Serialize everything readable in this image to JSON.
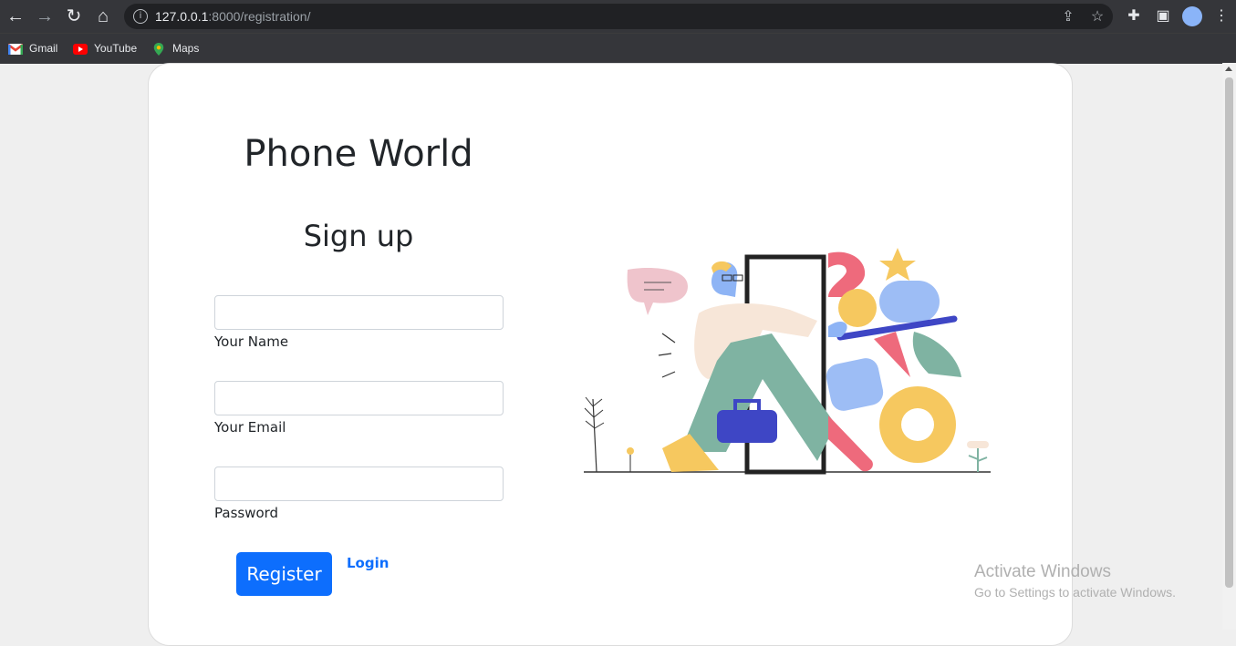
{
  "browser": {
    "url_host": "127.0.0.1",
    "url_path": ":8000/registration/",
    "bookmarks": [
      {
        "label": "Gmail",
        "icon": "gmail-icon"
      },
      {
        "label": "YouTube",
        "icon": "youtube-icon"
      },
      {
        "label": "Maps",
        "icon": "maps-icon"
      }
    ]
  },
  "page": {
    "brand": "Phone World",
    "heading": "Sign up",
    "fields": [
      {
        "label": "Your Name",
        "value": ""
      },
      {
        "label": "Your Email",
        "value": ""
      },
      {
        "label": "Password",
        "value": ""
      }
    ],
    "register_label": "Register",
    "login_label": "Login"
  },
  "watermark": {
    "line1": "Activate Windows",
    "line2": "Go to Settings to activate Windows."
  },
  "colors": {
    "primary": "#0d6efd",
    "chrome_bg": "#35363a"
  }
}
